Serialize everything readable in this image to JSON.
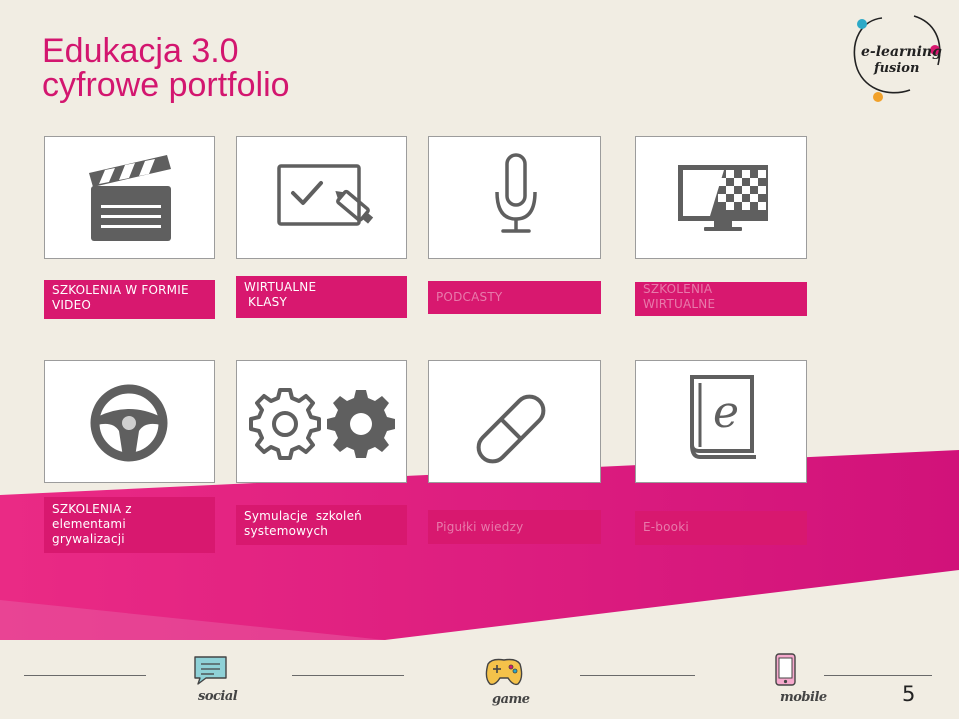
{
  "slide": {
    "title_line1": "Edukacja 3.0",
    "title_line2": "cyfrowe portfolio",
    "page_number": "5"
  },
  "logo": {
    "line1": "e-learning",
    "line2": "fusion"
  },
  "cards": [
    {
      "icon": "clapperboard-icon",
      "label_lines": [
        "SZKOLENIA W FORMIE",
        "VIDEO"
      ]
    },
    {
      "icon": "whiteboard-marker-icon",
      "label_lines": [
        "WIRTUALNE",
        " KLASY"
      ]
    },
    {
      "icon": "microphone-icon",
      "label_lines": [
        "PODCASTY"
      ]
    },
    {
      "icon": "monitor-icon",
      "label_lines": [
        "SZKOLENIA",
        "WIRTUALNE"
      ]
    },
    {
      "icon": "steering-wheel-icon",
      "label_lines": [
        "SZKOLENIA z",
        "elementami",
        "grywalizacji"
      ]
    },
    {
      "icon": "gears-icon",
      "label_lines": [
        "Symulacje  szkoleń",
        "systemowych"
      ]
    },
    {
      "icon": "pill-icon",
      "label_lines": [
        "Pigułki wiedzy"
      ]
    },
    {
      "icon": "ebook-icon",
      "label_lines": [
        "E-booki"
      ]
    }
  ],
  "footer": {
    "items": [
      {
        "icon": "chat-bubble-icon",
        "label": "social"
      },
      {
        "icon": "gamepad-icon",
        "label": "game"
      },
      {
        "icon": "smartphone-icon",
        "label": "mobile"
      }
    ]
  },
  "colors": {
    "accent": "#d8186f",
    "background": "#f1ede3",
    "icon_gray": "#5f5f5f"
  }
}
